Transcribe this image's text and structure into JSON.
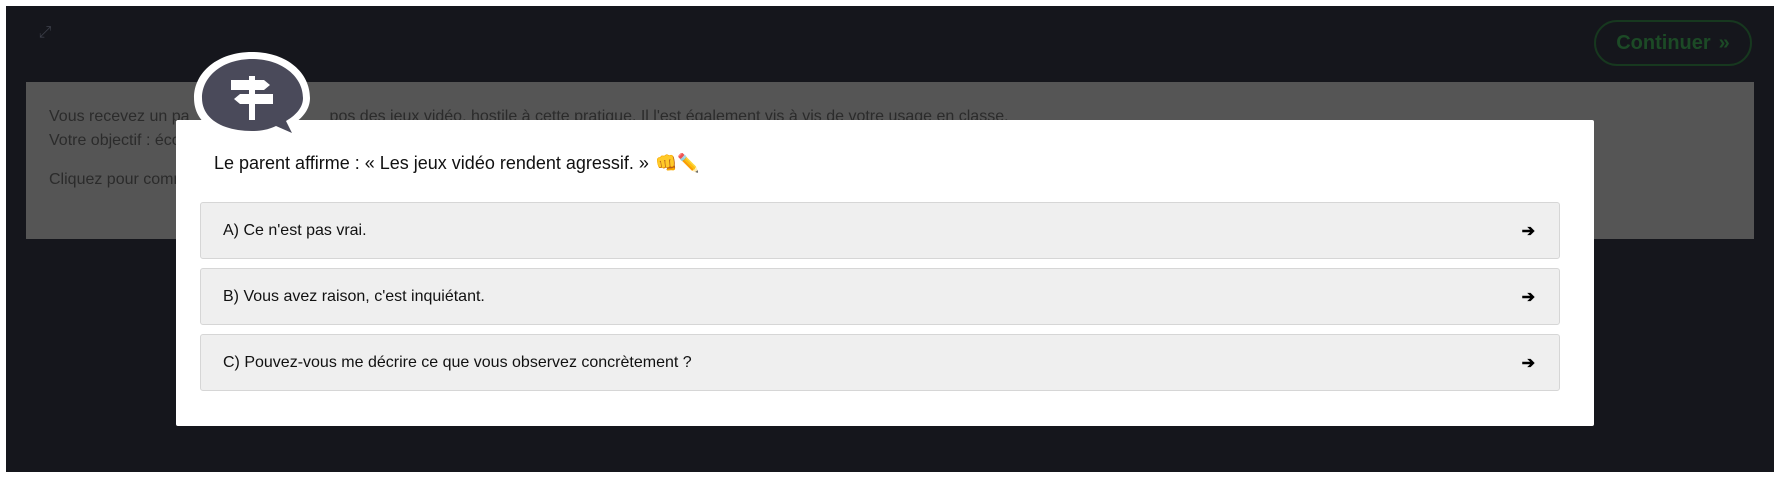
{
  "toolbar": {
    "expand_icon": "expand-icon",
    "continue_label": "Continuer",
    "continue_icon": "»"
  },
  "scenario": {
    "line1": "Vous recevez un pa",
    "line1_tail": "pos des jeux vidéo, hostile à cette pratique. Il l'est également vis à vis de votre usage en classe.",
    "line2": "Votre objectif : écou",
    "line3": "Cliquez pour comm"
  },
  "modal": {
    "badge_icon": "signpost-icon",
    "question": "Le parent affirme : « Les jeux vidéo rendent agressif. »",
    "question_emoji": "👊✏️",
    "options": [
      {
        "label": "A) Ce n'est pas vrai.",
        "arrow": "➔"
      },
      {
        "label": "B) Vous avez raison, c'est inquiétant.",
        "arrow": "➔"
      },
      {
        "label": "C) Pouvez-vous me décrire ce que vous observez concrètement ?",
        "arrow": "➔"
      }
    ]
  },
  "colors": {
    "background": "#15161c",
    "accent_green": "#1c4a26",
    "option_bg": "#efefef",
    "badge": "#4a4a5a"
  }
}
